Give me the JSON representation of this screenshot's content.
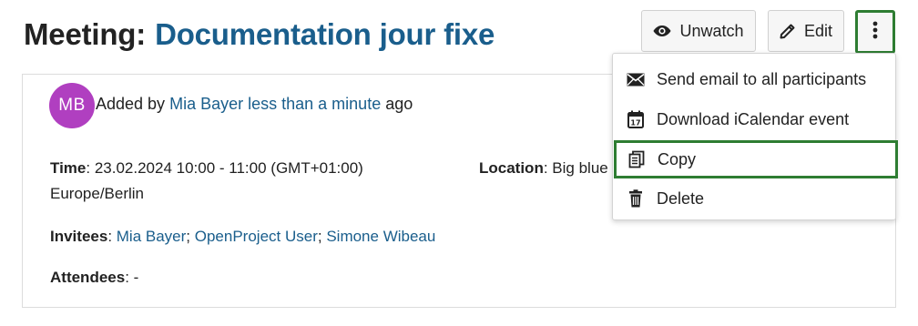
{
  "header": {
    "title_prefix": "Meeting:",
    "title_name": "Documentation jour fixe"
  },
  "toolbar": {
    "unwatch_label": "Unwatch",
    "edit_label": "Edit",
    "more_icon": "vertical-ellipsis-icon"
  },
  "meeting": {
    "author_initials": "MB",
    "added_prefix": "Added by",
    "author_name": "Mia Bayer",
    "added_time": "less than a minute",
    "added_suffix": "ago",
    "time_label": "Time",
    "time_value": "23.02.2024 10:00 - 11:00 (GMT+01:00)",
    "time_zone": "Europe/Berlin",
    "location_label": "Location",
    "location_value": "Big blue",
    "invitees_label": "Invitees",
    "invitees": [
      "Mia Bayer",
      "OpenProject User",
      "Simone Wibeau"
    ],
    "attendees_label": "Attendees",
    "attendees_value": "-"
  },
  "menu": {
    "items": [
      {
        "label": "Send email to all participants",
        "icon": "envelope-icon"
      },
      {
        "label": "Download iCalendar event",
        "icon": "calendar-icon"
      },
      {
        "label": "Copy",
        "icon": "copy-icon"
      },
      {
        "label": "Delete",
        "icon": "trash-icon"
      }
    ]
  },
  "colors": {
    "link": "#1a5e8c",
    "avatar": "#b03fc0",
    "highlight": "#2e7d32"
  }
}
